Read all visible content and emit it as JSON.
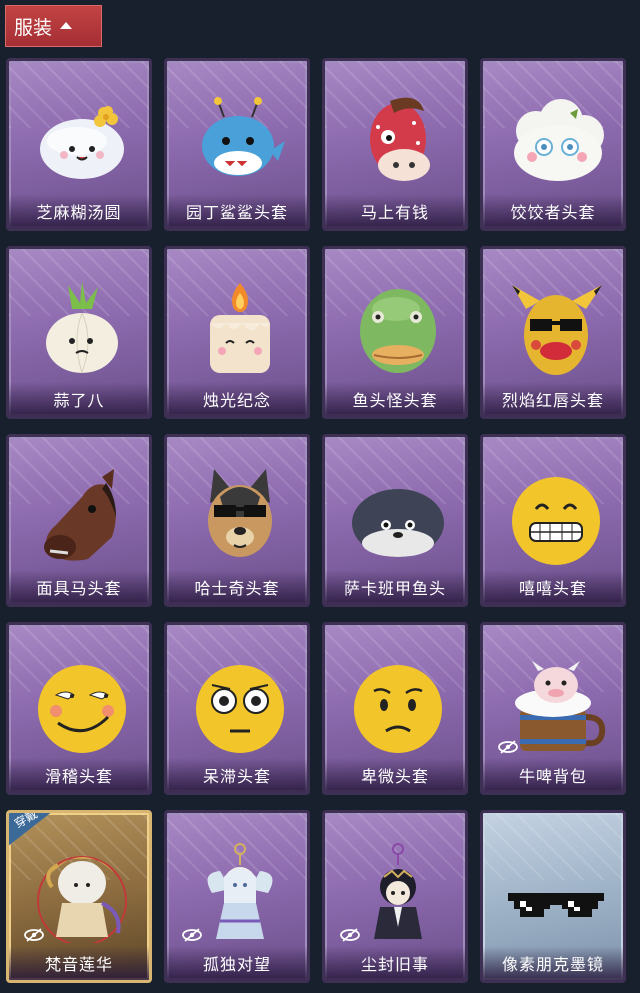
{
  "header": {
    "tab_label": "服装"
  },
  "status": {
    "equipped_badge": "穿戴"
  },
  "items": [
    {
      "label": "芝麻糊汤圆",
      "icon": "white-dumpling-icon",
      "hidden": false
    },
    {
      "label": "园丁鲨鲨头套",
      "icon": "blue-shark-icon",
      "hidden": false
    },
    {
      "label": "马上有钱",
      "icon": "red-horse-icon",
      "hidden": false
    },
    {
      "label": "饺饺者头套",
      "icon": "dumpling-head-icon",
      "hidden": false
    },
    {
      "label": "蒜了八",
      "icon": "garlic-icon",
      "hidden": false
    },
    {
      "label": "烛光纪念",
      "icon": "candle-icon",
      "hidden": false
    },
    {
      "label": "鱼头怪头套",
      "icon": "fish-head-icon",
      "hidden": false
    },
    {
      "label": "烈焰红唇头套",
      "icon": "pikachu-mask-icon",
      "hidden": false
    },
    {
      "label": "面具马头套",
      "icon": "horse-mask-icon",
      "hidden": false
    },
    {
      "label": "哈士奇头套",
      "icon": "husky-head-icon",
      "hidden": false
    },
    {
      "label": "萨卡班甲鱼头",
      "icon": "sacabambaspis-icon",
      "hidden": false
    },
    {
      "label": "嘻嘻头套",
      "icon": "grin-emoji-icon",
      "hidden": false
    },
    {
      "label": "滑稽头套",
      "icon": "smirk-emoji-icon",
      "hidden": false
    },
    {
      "label": "呆滞头套",
      "icon": "flushed-emoji-icon",
      "hidden": false
    },
    {
      "label": "卑微头套",
      "icon": "pleading-emoji-icon",
      "hidden": false
    },
    {
      "label": "牛啤背包",
      "icon": "cow-beer-backpack-icon",
      "hidden": true
    },
    {
      "label": "梵音莲华",
      "icon": "lotus-character-icon",
      "hidden": true,
      "equipped": true
    },
    {
      "label": "孤独对望",
      "icon": "angel-charm-icon",
      "hidden": true
    },
    {
      "label": "尘封旧事",
      "icon": "dark-figure-charm-icon",
      "hidden": true
    },
    {
      "label": "像素朋克墨镜",
      "icon": "pixel-sunglasses-icon",
      "hidden": false,
      "light": true
    }
  ]
}
